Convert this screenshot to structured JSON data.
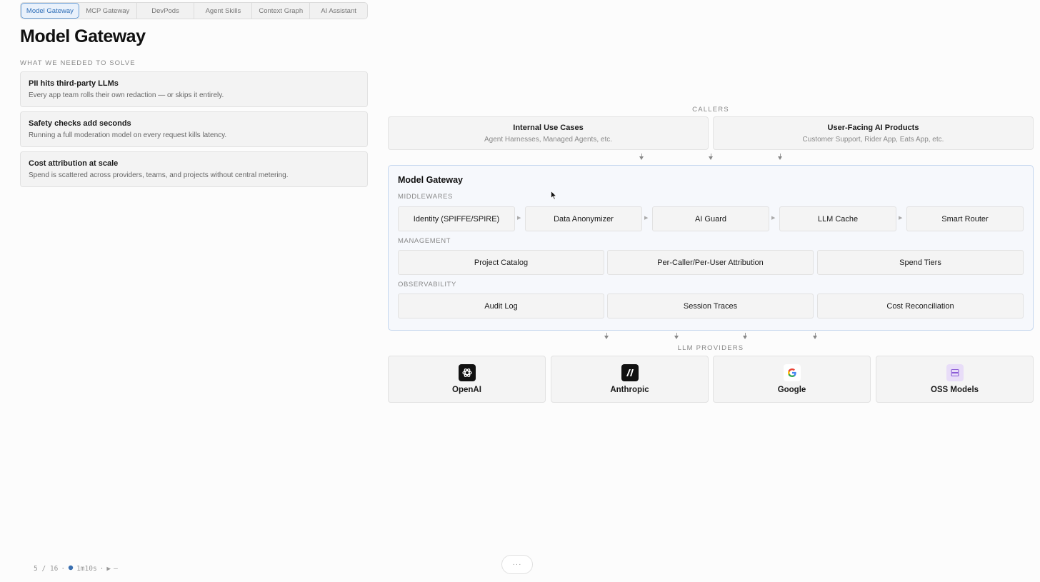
{
  "tabs": [
    "Model Gateway",
    "MCP Gateway",
    "DevPods",
    "Agent Skills",
    "Context Graph",
    "AI Assistant"
  ],
  "page_title": "Model Gateway",
  "problems_label": "WHAT WE NEEDED TO SOLVE",
  "problems": [
    {
      "title": "PII hits third-party LLMs",
      "desc": "Every app team rolls their own redaction — or skips it entirely."
    },
    {
      "title": "Safety checks add seconds",
      "desc": "Running a full moderation model on every request kills latency."
    },
    {
      "title": "Cost attribution at scale",
      "desc": "Spend is scattered across providers, teams, and projects without central metering."
    }
  ],
  "diagram": {
    "callers_label": "CALLERS",
    "callers": [
      {
        "title": "Internal Use Cases",
        "sub": "Agent Harnesses, Managed Agents, etc."
      },
      {
        "title": "User-Facing AI Products",
        "sub": "Customer Support, Rider App, Eats App, etc."
      }
    ],
    "gateway_title": "Model Gateway",
    "middlewares_label": "MIDDLEWARES",
    "middlewares": [
      "Identity (SPIFFE/SPIRE)",
      "Data Anonymizer",
      "AI Guard",
      "LLM Cache",
      "Smart Router"
    ],
    "management_label": "MANAGEMENT",
    "management": [
      "Project Catalog",
      "Per-Caller/Per-User Attribution",
      "Spend Tiers"
    ],
    "observability_label": "OBSERVABILITY",
    "observability": [
      "Audit Log",
      "Session Traces",
      "Cost Reconciliation"
    ],
    "providers_label": "LLM PROVIDERS",
    "providers": [
      {
        "name": "OpenAI",
        "icon": "openai-icon"
      },
      {
        "name": "Anthropic",
        "icon": "anthropic-icon"
      },
      {
        "name": "Google",
        "icon": "google-icon"
      },
      {
        "name": "OSS Models",
        "icon": "server-icon"
      }
    ]
  },
  "footer": {
    "slide": "5 / 16",
    "time": "1m10s",
    "extra": "—"
  },
  "more_button": "···"
}
